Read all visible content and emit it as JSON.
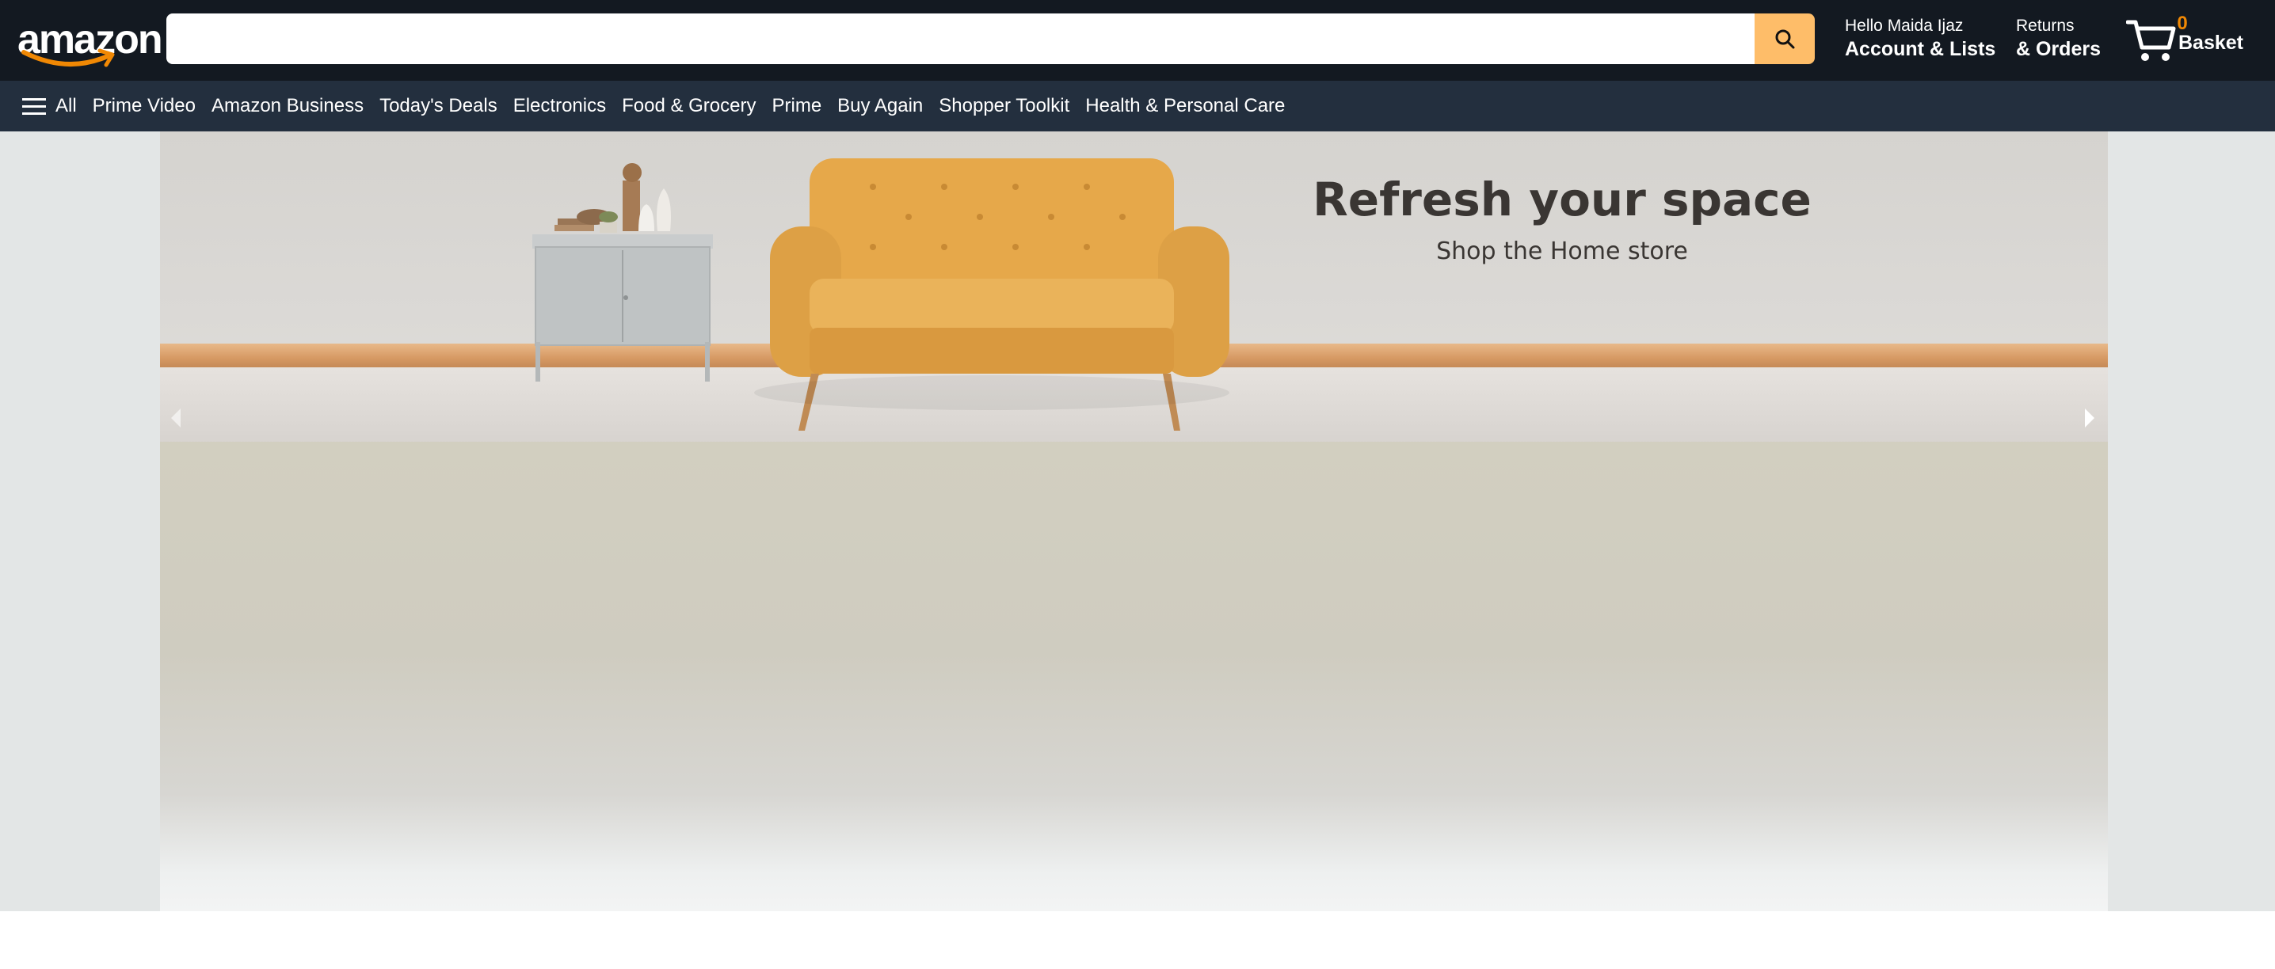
{
  "header": {
    "logo_text": "amazon",
    "search": {
      "value": "",
      "placeholder": ""
    },
    "account": {
      "greeting": "Hello Maida Ijaz",
      "label": "Account & Lists"
    },
    "orders": {
      "line1": "Returns",
      "line2": "& Orders"
    },
    "basket": {
      "count": "0",
      "label": "Basket"
    }
  },
  "subnav": {
    "all_label": "All",
    "items": [
      "Prime Video",
      "Amazon Business",
      "Today's Deals",
      "Electronics",
      "Food & Grocery",
      "Prime",
      "Buy Again",
      "Shopper Toolkit",
      "Health & Personal Care"
    ]
  },
  "hero": {
    "title": "Refresh your space",
    "subtitle": "Shop the Home store"
  },
  "colors": {
    "nav_dark": "#131921",
    "subnav": "#232f3e",
    "search_button": "#febd69",
    "cart_count": "#f08804",
    "page_bg": "#e3e6e6"
  },
  "icons": [
    "menu-icon",
    "search-icon",
    "cart-icon",
    "chevron-left-icon",
    "chevron-right-icon",
    "amazon-smile-icon"
  ]
}
